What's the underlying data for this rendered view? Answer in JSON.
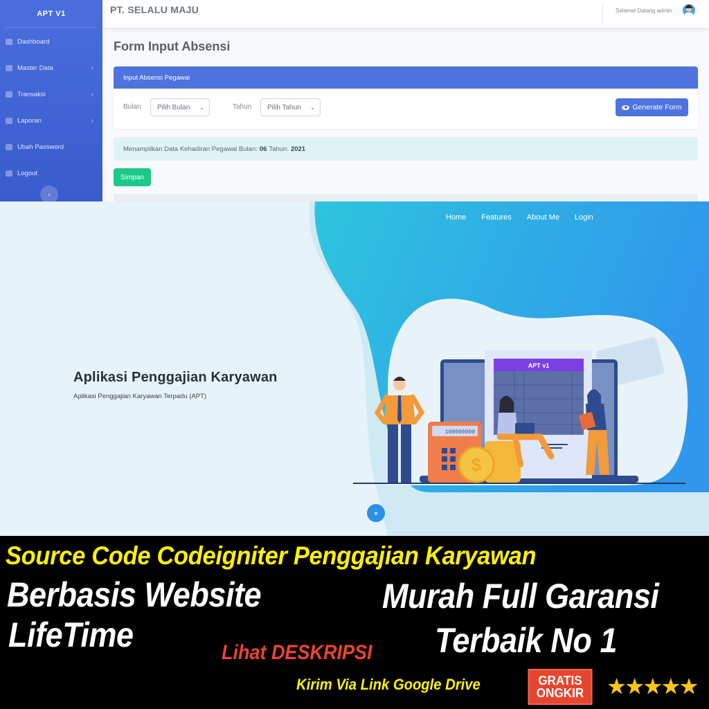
{
  "admin": {
    "sidebar": {
      "brand": "APT V1",
      "items": [
        {
          "label": "Dashboard",
          "icon": "dashboard-icon",
          "has_submenu": false
        },
        {
          "label": "Master Data",
          "icon": "database-icon",
          "has_submenu": true
        },
        {
          "label": "Transaksi",
          "icon": "credit-card-icon",
          "has_submenu": true
        },
        {
          "label": "Laporan",
          "icon": "report-icon",
          "has_submenu": true
        },
        {
          "label": "Ubah Password",
          "icon": "lock-icon",
          "has_submenu": false
        },
        {
          "label": "Logout",
          "icon": "logout-icon",
          "has_submenu": false
        }
      ],
      "chevron": "›",
      "collapse": "‹"
    },
    "topbar": {
      "company": "PT. SELALU MAJU",
      "welcome": "Selamat Datang admin"
    },
    "page_title": "Form Input Absensi",
    "card": {
      "header": "Input Absensi Pegawai",
      "month_label": "Bulan",
      "month_select": "Pilih Bulan",
      "year_label": "Tahun",
      "year_select": "Pilih Tahun",
      "caret": "⌄",
      "generate_button": "Generate Form"
    },
    "alert": {
      "prefix": "Menampilkan Data Kehadiran Pegawai Bulan:",
      "month": "06",
      "year_label": "Tahun:",
      "year": "2021"
    },
    "save_button": "Simpan",
    "colors": {
      "primary": "#4e73df",
      "success": "#1cc88a",
      "info_bg": "#dff3f5"
    }
  },
  "landing": {
    "nav": [
      "Home",
      "Features",
      "About Me",
      "Login"
    ],
    "title": "Aplikasi Penggajian Karyawan",
    "subtitle": "Aplikasi Penggajian Karyawan Terpadu (APT)",
    "illustration_screen_title": "APT v1",
    "calculator_display": "100000000",
    "scroll_icon": "»",
    "colors": {
      "blob_start": "#2ec4de",
      "blob_end": "#2f97ec",
      "accent_purple": "#7b3fe4"
    }
  },
  "banner": {
    "headline": "Source Code Codeigniter Penggajian Karyawan",
    "line1_left": "Berbasis Website",
    "line1_right": "Murah Full Garansi",
    "line2_left": "LifeTime",
    "line2_right": "Terbaik No 1",
    "description_link": "Lihat DESKRIPSI",
    "delivery": "Kirim Via Link Google Drive",
    "badge_line1": "GRATIS",
    "badge_line2": "ONGKIR",
    "rating_stars": 5,
    "rating_max": 5,
    "star_glyph": "★",
    "colors": {
      "headline": "#fff200",
      "description": "#e8452e",
      "badge": "#e8452e"
    }
  }
}
